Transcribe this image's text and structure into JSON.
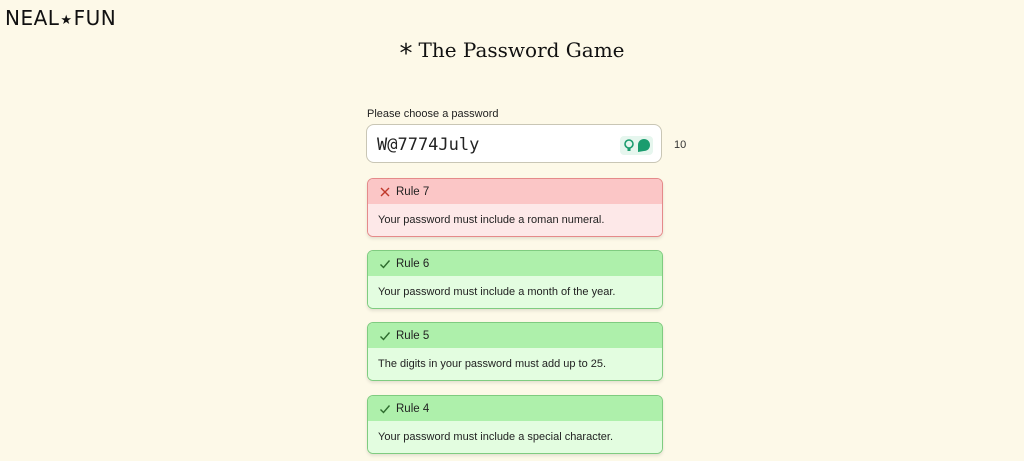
{
  "logo": {
    "left": "NEAL",
    "star": "★",
    "right": "FUN"
  },
  "title": {
    "star": "*",
    "text": "The Password Game"
  },
  "password": {
    "prompt": "Please choose a password",
    "value": "W@7774July",
    "length": "10"
  },
  "rules": [
    {
      "label": "Rule 7",
      "text": "Your password must include a roman numeral.",
      "status": "fail"
    },
    {
      "label": "Rule 6",
      "text": "Your password must include a month of the year.",
      "status": "pass"
    },
    {
      "label": "Rule 5",
      "text": "The digits in your password must add up to 25.",
      "status": "pass"
    },
    {
      "label": "Rule 4",
      "text": "Your password must include a special character.",
      "status": "pass"
    }
  ],
  "colors": {
    "background": "#fdf9e8",
    "fail_header": "#fbc6c6",
    "fail_body": "#fde8e8",
    "pass_header": "#aef0ab",
    "pass_body": "#e3fde0",
    "extension_green": "#1a9c6e"
  },
  "icons": {
    "rule_fail": "x-icon",
    "rule_pass": "check-icon",
    "extension_1": "lightbulb-icon",
    "extension_2": "chat-bubble-icon"
  }
}
